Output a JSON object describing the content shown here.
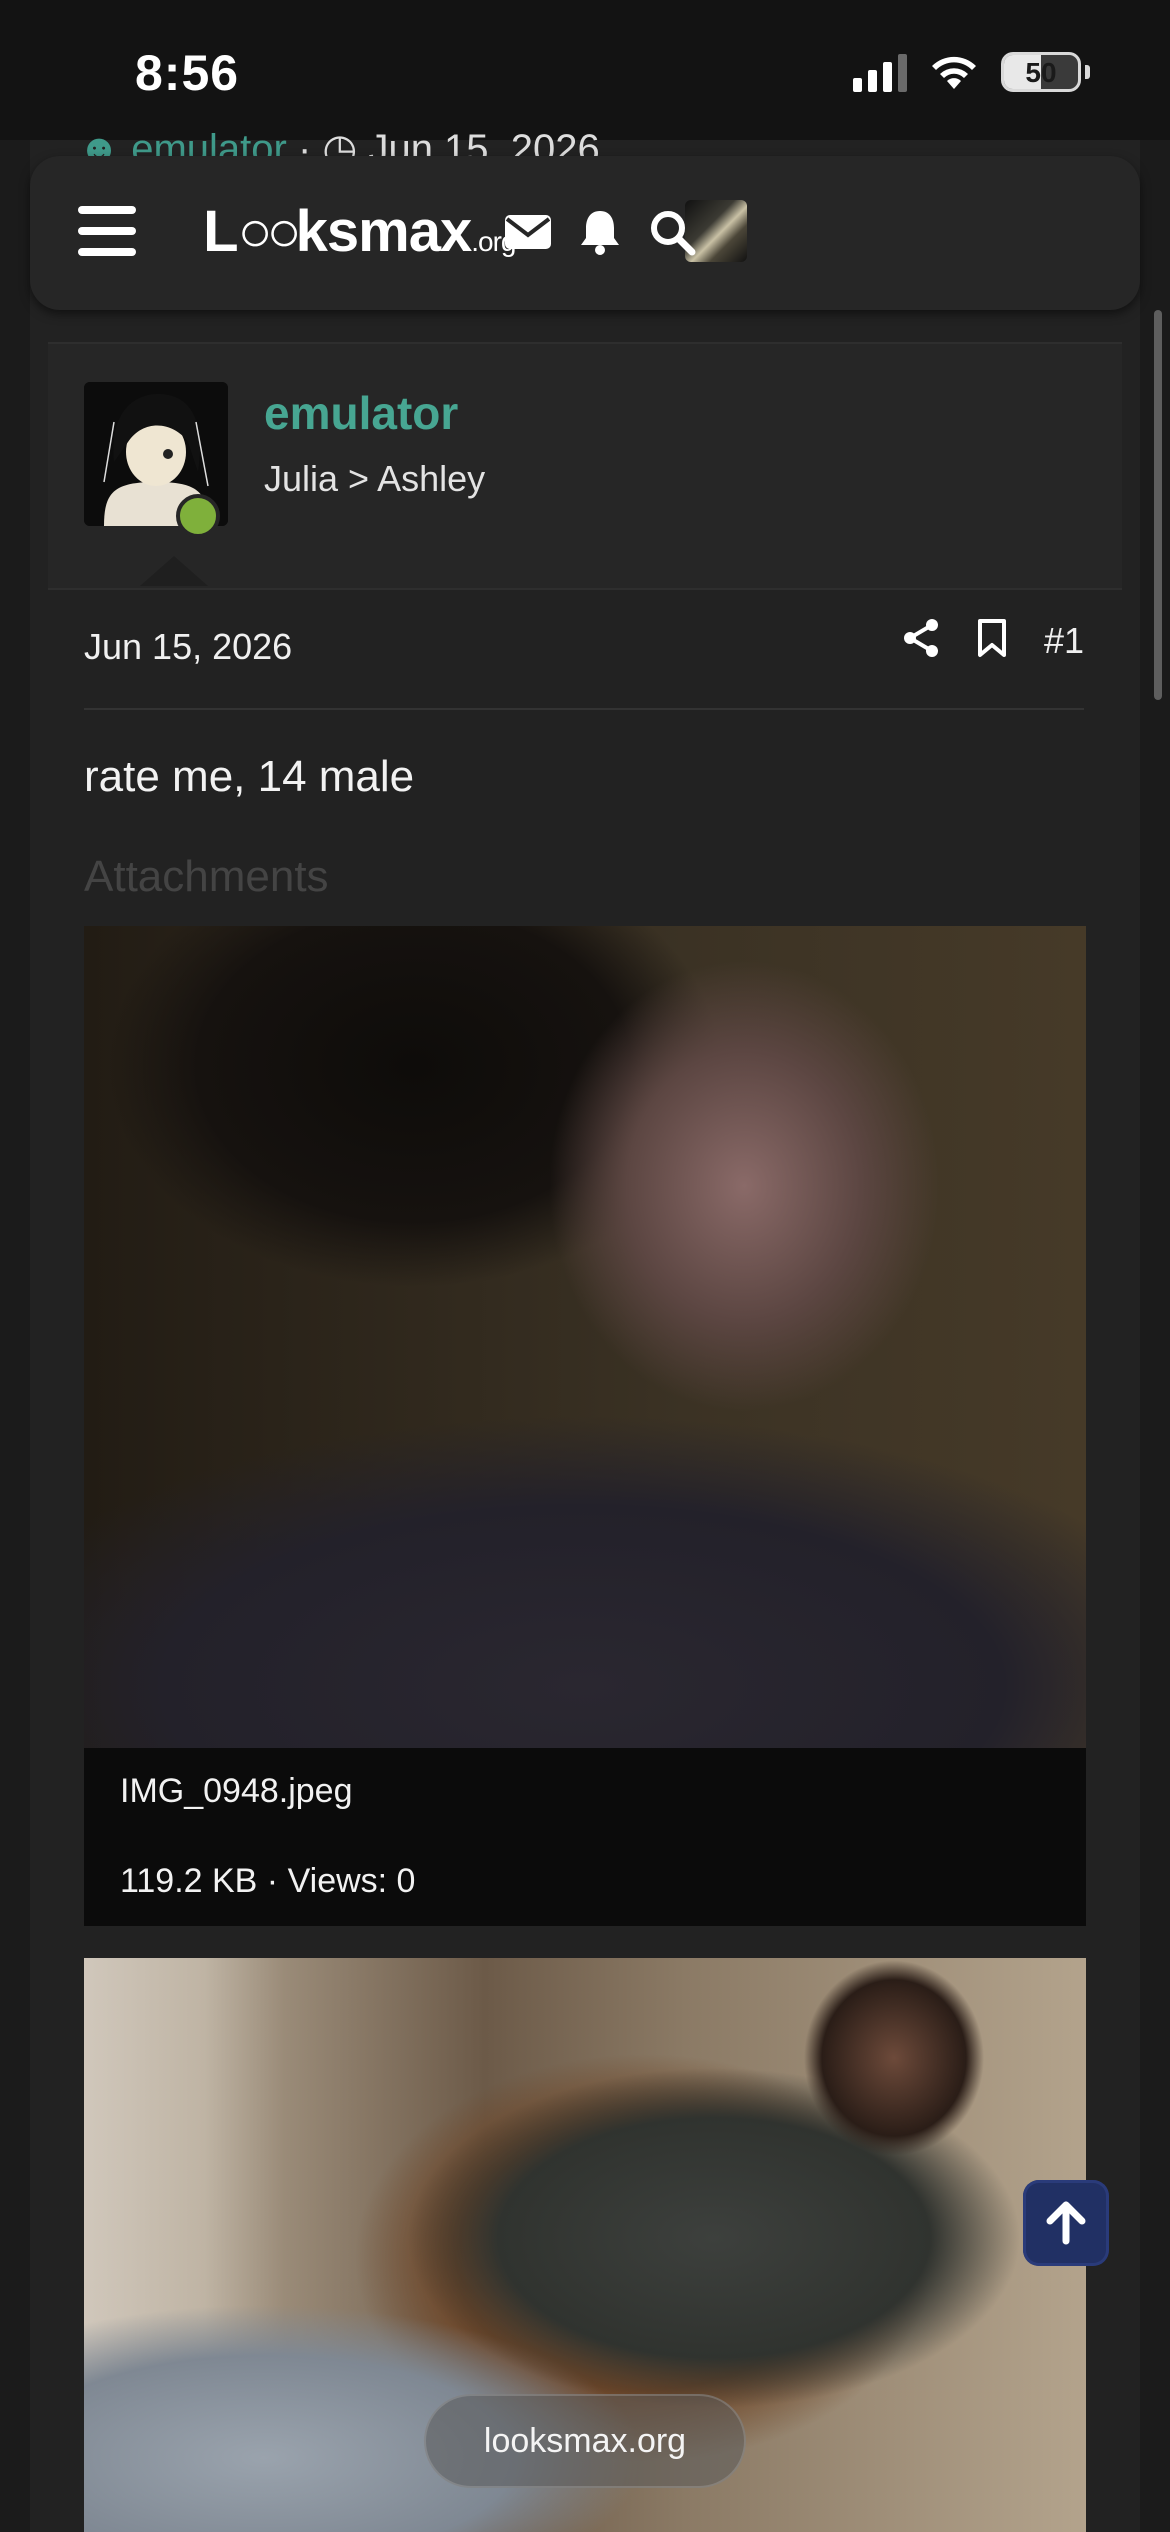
{
  "status_bar": {
    "time": "8:56",
    "battery": "50",
    "battery_level": 0.5
  },
  "behind_header": {
    "user": "emulator",
    "separator": "·",
    "date": "Jun 15, 2026"
  },
  "header": {
    "logo_main": "Lksmax",
    "logo_suffix": ".org",
    "icons": [
      "menu-icon",
      "avatar",
      "envelope-icon",
      "bell-icon",
      "search-icon"
    ]
  },
  "post": {
    "username": "emulator",
    "user_title": "Julia > Ashley",
    "online": true,
    "date": "Jun 15, 2026",
    "post_number": "#1",
    "body": "rate me, 14 male",
    "attachments_label": "Attachments",
    "attachments": [
      {
        "filename": "IMG_0948.jpeg",
        "meta": "119.2 KB · Views: 0"
      }
    ]
  },
  "footer": {
    "site_label": "looksmax.org"
  },
  "colors": {
    "accent": "#47a692",
    "online": "#7fb03b",
    "back_to_top": "#213064"
  }
}
